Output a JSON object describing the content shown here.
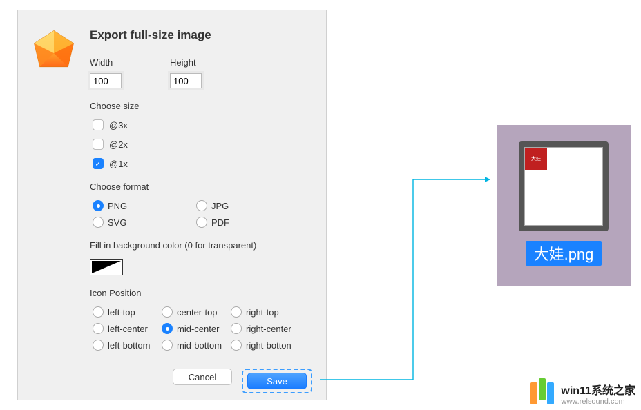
{
  "dialog": {
    "title": "Export full-size image",
    "width": {
      "label": "Width",
      "value": "100"
    },
    "height": {
      "label": "Height",
      "value": "100"
    },
    "chooseSize": {
      "header": "Choose size",
      "options": [
        "@3x",
        "@2x",
        "@1x"
      ],
      "selected": "@1x"
    },
    "chooseFormat": {
      "header": "Choose format",
      "options": [
        "PNG",
        "JPG",
        "SVG",
        "PDF"
      ],
      "selected": "PNG"
    },
    "bgColor": {
      "header": "Fill in background color (0 for transparent)"
    },
    "iconPosition": {
      "header": "Icon Position",
      "options": [
        [
          "left-top",
          "center-top",
          "right-top"
        ],
        [
          "left-center",
          "mid-center",
          "right-center"
        ],
        [
          "left-bottom",
          "mid-bottom",
          "right-botton"
        ]
      ],
      "selected": "mid-center"
    },
    "buttons": {
      "cancel": "Cancel",
      "save": "Save"
    }
  },
  "preview": {
    "thumbLabel": "大娃",
    "filename": "大娃.png"
  },
  "watermark": {
    "title": "win11系统之家",
    "url": "www.relsound.com",
    "colors": [
      "#ff9933",
      "#66cc33",
      "#33aaff"
    ]
  }
}
